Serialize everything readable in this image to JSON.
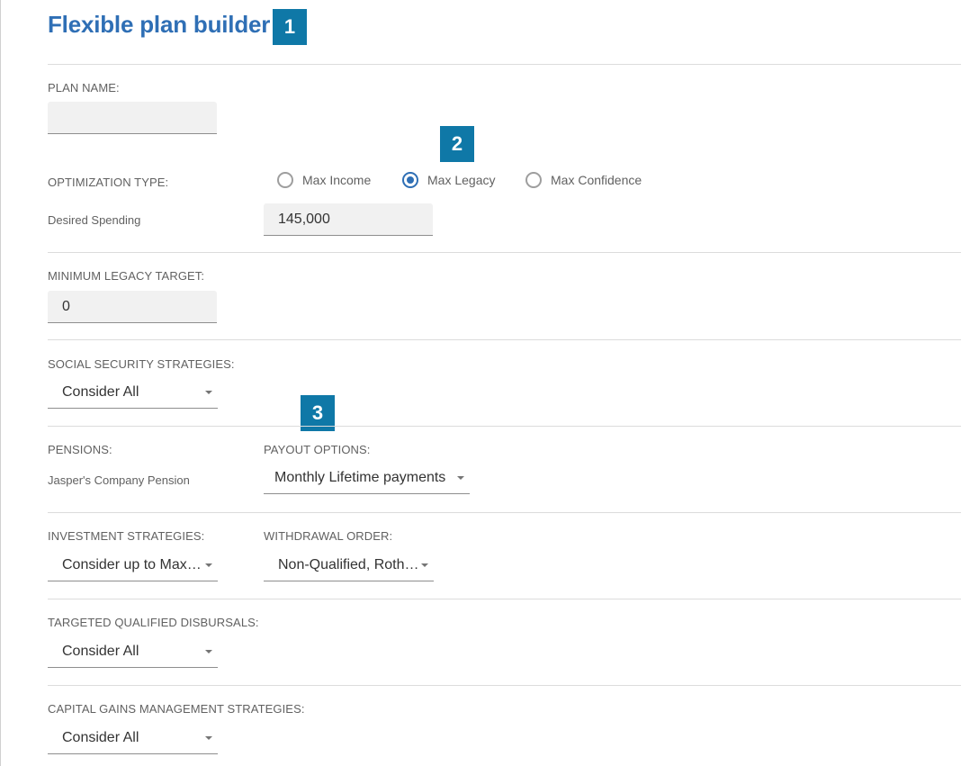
{
  "page": {
    "title": "Flexible plan builder"
  },
  "badges": [
    "1",
    "2",
    "3"
  ],
  "plan_name": {
    "label": "PLAN NAME:",
    "value": ""
  },
  "optimization": {
    "label": "OPTIMIZATION TYPE:",
    "options": [
      "Max Income",
      "Max Legacy",
      "Max Confidence"
    ],
    "selected": "Max Legacy",
    "desired_spending_label": "Desired Spending",
    "desired_spending_value": "145,000"
  },
  "minimum_legacy": {
    "label": "MINIMUM LEGACY TARGET:",
    "value": "0"
  },
  "social_security": {
    "label": "SOCIAL SECURITY STRATEGIES:",
    "value": "Consider All"
  },
  "pensions": {
    "label": "PENSIONS:",
    "name": "Jasper's Company Pension",
    "payout_label": "PAYOUT OPTIONS:",
    "payout_value": "Monthly Lifetime payments"
  },
  "investment": {
    "label": "INVESTMENT STRATEGIES:",
    "value": "Consider up to Max ...",
    "withdrawal_label": "WITHDRAWAL ORDER:",
    "withdrawal_value": "Non-Qualified, Roth, ..."
  },
  "qualified_disbursals": {
    "label": "TARGETED QUALIFIED DISBURSALS:",
    "value": "Consider All"
  },
  "capital_gains": {
    "label": "CAPITAL GAINS MANAGEMENT STRATEGIES:",
    "value": "Consider All"
  },
  "colors": {
    "accent": "#2f6fb5",
    "badge": "#0f78a7"
  }
}
